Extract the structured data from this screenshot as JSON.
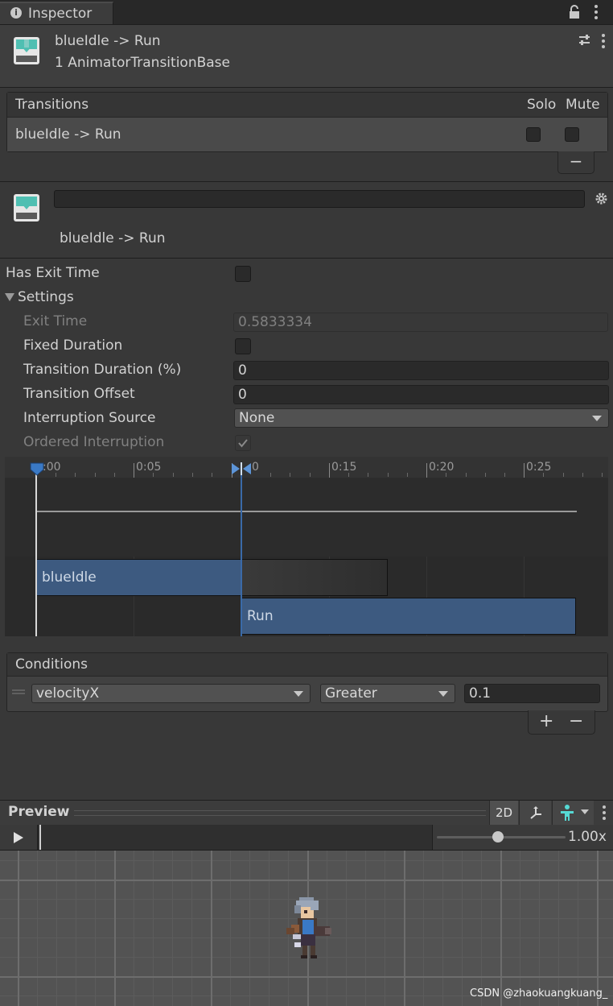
{
  "window": {
    "tab_title": "Inspector",
    "info_glyph": "i"
  },
  "header": {
    "title": "blueIdle -> Run",
    "subtitle": "1 AnimatorTransitionBase"
  },
  "transitions": {
    "label": "Transitions",
    "col_solo": "Solo",
    "col_mute": "Mute",
    "rows": [
      {
        "name": "blueIdle -> Run",
        "solo": false,
        "mute": false
      }
    ],
    "remove_label": "−"
  },
  "transition": {
    "name_value": "",
    "caption": "blueIdle -> Run",
    "has_exit_time_label": "Has Exit Time",
    "has_exit_time": false,
    "settings_label": "Settings",
    "exit_time_label": "Exit Time",
    "exit_time_value": "0.5833334",
    "fixed_duration_label": "Fixed Duration",
    "fixed_duration": false,
    "transition_duration_label": "Transition Duration (%)",
    "transition_duration_value": "0",
    "transition_offset_label": "Transition Offset",
    "transition_offset_value": "0",
    "interruption_source_label": "Interruption Source",
    "interruption_source_value": "None",
    "ordered_interruption_label": "Ordered Interruption",
    "ordered_interruption": true
  },
  "timeline": {
    "ticks": [
      ":00",
      "0:05",
      "0",
      "0:15",
      "0:20",
      "0:25"
    ],
    "source_clip": "blueIdle",
    "dest_clip": "Run"
  },
  "conditions": {
    "label": "Conditions",
    "items": [
      {
        "parameter": "velocityX",
        "mode": "Greater",
        "threshold": "0.1"
      }
    ],
    "add_label": "+",
    "remove_label": "−"
  },
  "preview": {
    "label": "Preview",
    "mode_2d": "2D",
    "speed": "1.00x",
    "watermark": "CSDN @zhaokuangkuang_"
  },
  "colors": {
    "clip_blue": "#3d5a80",
    "accent_blue": "#3a79c5",
    "avatar_teal": "#56d9d4"
  }
}
